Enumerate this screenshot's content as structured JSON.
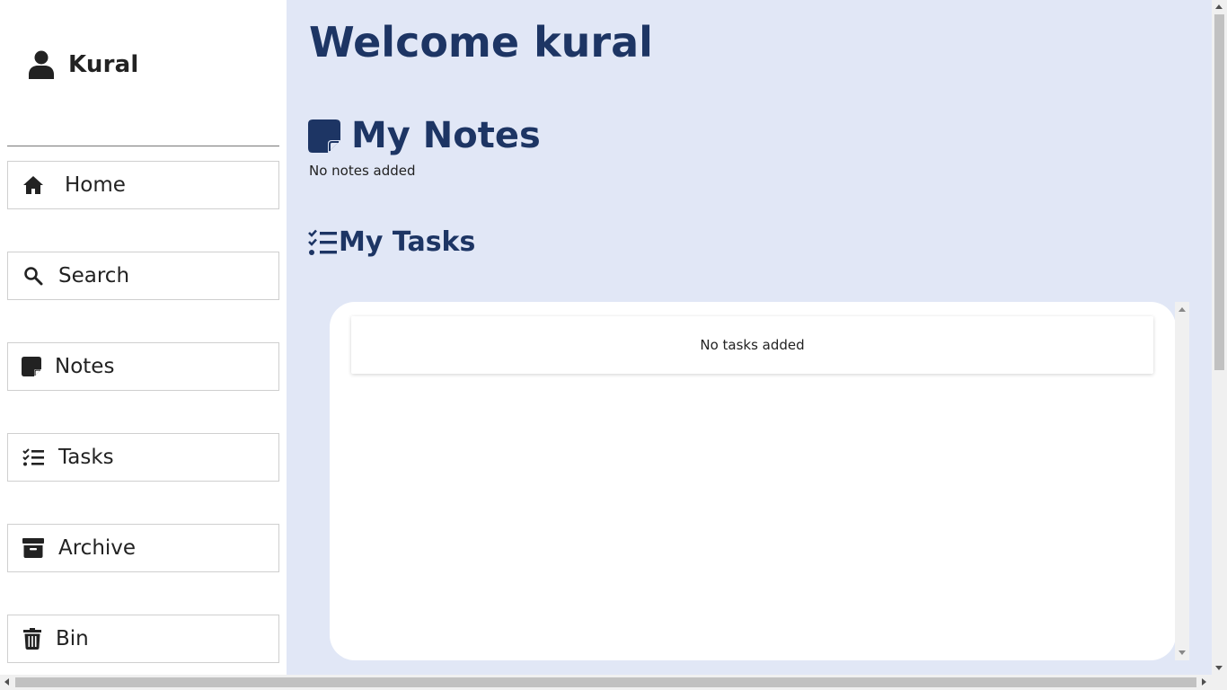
{
  "sidebar": {
    "user_name": "Kural",
    "items": [
      {
        "label": "Home",
        "icon": "home-icon"
      },
      {
        "label": "Search",
        "icon": "search-icon"
      },
      {
        "label": "Notes",
        "icon": "note-icon"
      },
      {
        "label": "Tasks",
        "icon": "task-list-icon"
      },
      {
        "label": "Archive",
        "icon": "archive-icon"
      },
      {
        "label": "Bin",
        "icon": "trash-icon"
      }
    ]
  },
  "main": {
    "welcome": "Welcome kural",
    "notes_title": "My Notes",
    "notes_empty": "No notes added",
    "tasks_title": "My Tasks",
    "tasks_empty": "No tasks added"
  },
  "colors": {
    "main_bg": "#e1e7f6",
    "heading": "#1d3564"
  }
}
